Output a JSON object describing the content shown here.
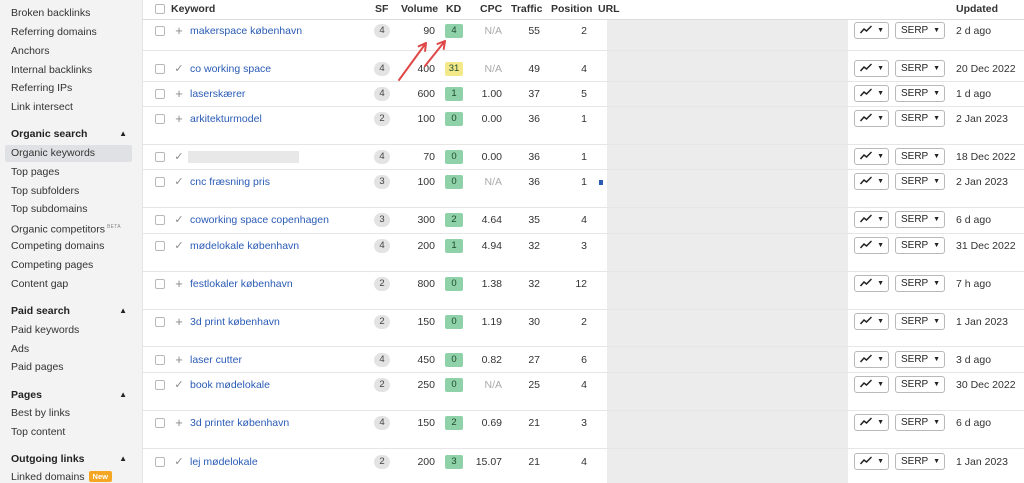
{
  "sidebar": {
    "items_top": [
      {
        "label": "Broken backlinks"
      },
      {
        "label": "Referring domains"
      },
      {
        "label": "Anchors"
      },
      {
        "label": "Internal backlinks"
      },
      {
        "label": "Referring IPs"
      },
      {
        "label": "Link intersect"
      }
    ],
    "organic_search": {
      "title": "Organic search",
      "items": [
        {
          "label": "Organic keywords",
          "active": true
        },
        {
          "label": "Top pages"
        },
        {
          "label": "Top subfolders"
        },
        {
          "label": "Top subdomains"
        },
        {
          "label": "Organic competitors",
          "badge": "BETA"
        },
        {
          "label": "Competing domains"
        },
        {
          "label": "Competing pages"
        },
        {
          "label": "Content gap"
        }
      ]
    },
    "paid_search": {
      "title": "Paid search",
      "items": [
        {
          "label": "Paid keywords"
        },
        {
          "label": "Ads"
        },
        {
          "label": "Paid pages"
        }
      ]
    },
    "pages": {
      "title": "Pages",
      "items": [
        {
          "label": "Best by links"
        },
        {
          "label": "Top content"
        }
      ]
    },
    "outgoing_links": {
      "title": "Outgoing links",
      "items": [
        {
          "label": "Linked domains",
          "badge": "New"
        }
      ]
    }
  },
  "table": {
    "headers": {
      "keyword": "Keyword",
      "sf": "SF",
      "volume": "Volume",
      "kd": "KD",
      "cpc": "CPC",
      "traffic": "Traffic",
      "position": "Position",
      "url": "URL",
      "updated": "Updated"
    },
    "serp_label": "SERP",
    "rows": [
      {
        "state": "plus",
        "keyword": "makerspace københavn",
        "sf": "4",
        "volume": "90",
        "kd": "4",
        "kd_color": "#8fd1a8",
        "cpc": "N/A",
        "traffic": "55",
        "position": "2",
        "updated": "2 d ago"
      },
      {
        "state": "check",
        "keyword": "co working space",
        "sf": "4",
        "volume": "400",
        "kd": "31",
        "kd_color": "#f3e98a",
        "cpc": "N/A",
        "traffic": "49",
        "position": "4",
        "updated": "20 Dec 2022"
      },
      {
        "state": "plus",
        "keyword": "laserskærer",
        "sf": "4",
        "volume": "600",
        "kd": "1",
        "kd_color": "#8fd1a8",
        "cpc": "1.00",
        "traffic": "37",
        "position": "5",
        "updated": "1 d ago"
      },
      {
        "state": "plus",
        "keyword": "arkitekturmodel",
        "sf": "2",
        "volume": "100",
        "kd": "0",
        "kd_color": "#8fd1a8",
        "cpc": "0.00",
        "traffic": "36",
        "position": "1",
        "updated": "2 Jan 2023"
      },
      {
        "state": "check",
        "keyword": "",
        "sf": "4",
        "volume": "70",
        "kd": "0",
        "kd_color": "#8fd1a8",
        "cpc": "0.00",
        "traffic": "36",
        "position": "1",
        "updated": "18 Dec 2022"
      },
      {
        "state": "check",
        "keyword": "cnc fræsning pris",
        "sf": "3",
        "volume": "100",
        "kd": "0",
        "kd_color": "#8fd1a8",
        "cpc": "N/A",
        "traffic": "36",
        "position": "1",
        "updated": "2 Jan 2023"
      },
      {
        "state": "check",
        "keyword": "coworking space copenhagen",
        "sf": "3",
        "volume": "300",
        "kd": "2",
        "kd_color": "#8fd1a8",
        "cpc": "4.64",
        "traffic": "35",
        "position": "4",
        "updated": "6 d ago"
      },
      {
        "state": "check",
        "keyword": "mødelokale københavn",
        "sf": "4",
        "volume": "200",
        "kd": "1",
        "kd_color": "#8fd1a8",
        "cpc": "4.94",
        "traffic": "32",
        "position": "3",
        "updated": "31 Dec 2022"
      },
      {
        "state": "plus",
        "keyword": "festlokaler københavn",
        "sf": "2",
        "volume": "800",
        "kd": "0",
        "kd_color": "#8fd1a8",
        "cpc": "1.38",
        "traffic": "32",
        "position": "12",
        "updated": "7 h ago"
      },
      {
        "state": "plus",
        "keyword": "3d print københavn",
        "sf": "2",
        "volume": "150",
        "kd": "0",
        "kd_color": "#8fd1a8",
        "cpc": "1.19",
        "traffic": "30",
        "position": "2",
        "updated": "1 Jan 2023"
      },
      {
        "state": "plus",
        "keyword": "laser cutter",
        "sf": "4",
        "volume": "450",
        "kd": "0",
        "kd_color": "#8fd1a8",
        "cpc": "0.82",
        "traffic": "27",
        "position": "6",
        "updated": "3 d ago"
      },
      {
        "state": "check",
        "keyword": "book mødelokale",
        "sf": "2",
        "volume": "250",
        "kd": "0",
        "kd_color": "#8fd1a8",
        "cpc": "N/A",
        "traffic": "25",
        "position": "4",
        "updated": "30 Dec 2022"
      },
      {
        "state": "plus",
        "keyword": "3d printer københavn",
        "sf": "4",
        "volume": "150",
        "kd": "2",
        "kd_color": "#8fd1a8",
        "cpc": "0.69",
        "traffic": "21",
        "position": "3",
        "updated": "6 d ago"
      },
      {
        "state": "check",
        "keyword": "lej mødelokale",
        "sf": "2",
        "volume": "200",
        "kd": "3",
        "kd_color": "#8fd1a8",
        "cpc": "15.07",
        "traffic": "21",
        "position": "4",
        "updated": "1 Jan 2023"
      }
    ]
  },
  "colors": {
    "link": "#2a5bb5",
    "annotation_arrow": "#e04848",
    "kd_easy": "#8fd1a8",
    "kd_medium": "#f3e98a"
  }
}
